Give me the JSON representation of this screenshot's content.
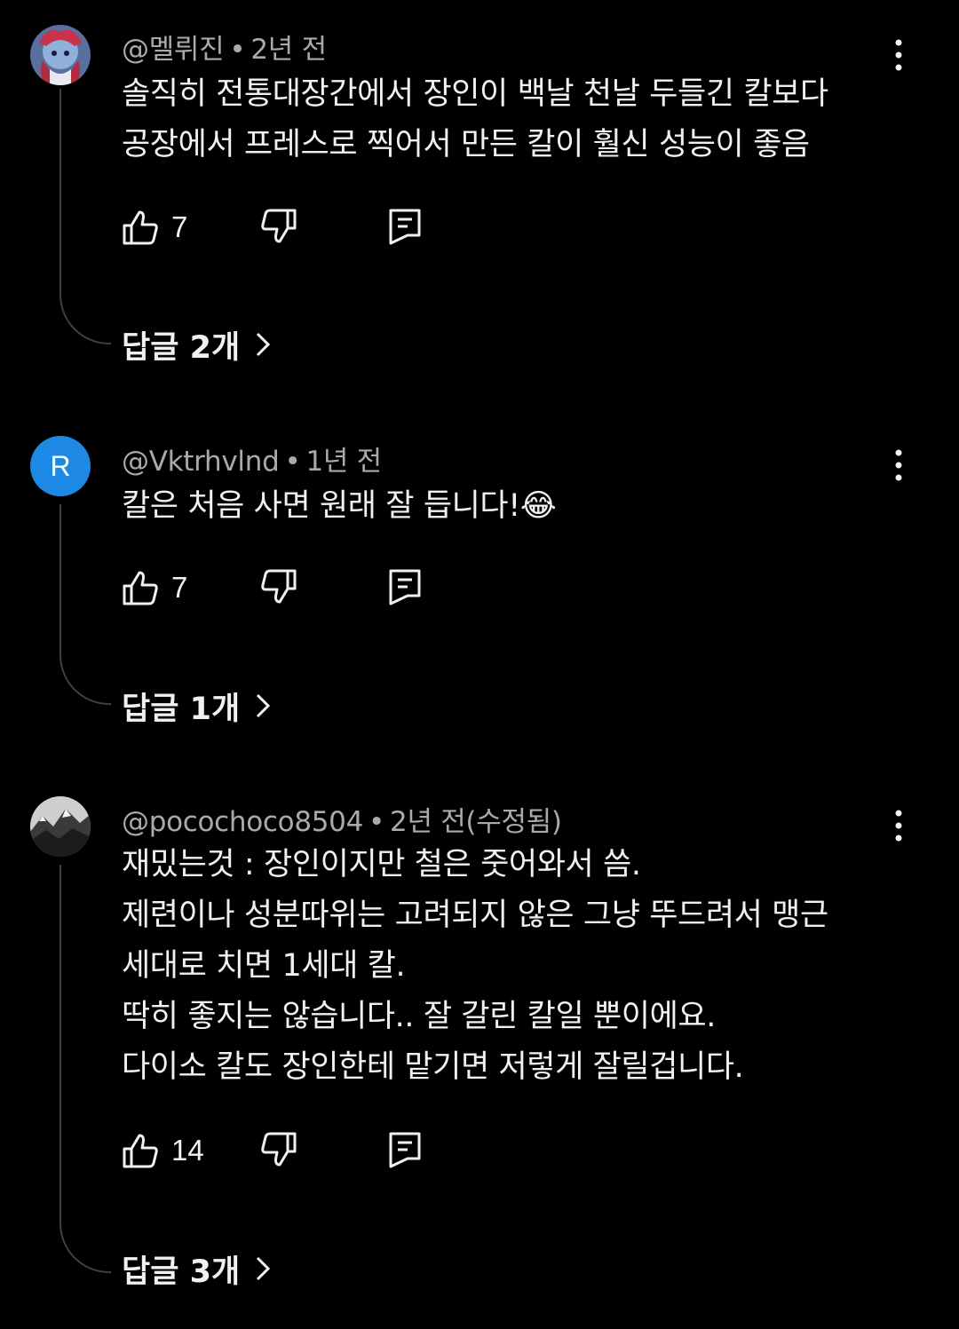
{
  "colors": {
    "background": "#000000",
    "text_primary": "#f1f1f1",
    "text_secondary": "#aaaaaa",
    "thread_line": "#3f3f3f",
    "avatar_letter_bg": "#1e88e5"
  },
  "comments": [
    {
      "author": "@멜뤼진",
      "time": "2년 전",
      "avatar": {
        "type": "image",
        "icon": "anime-avatar"
      },
      "lines": [
        "솔직히 전통대장간에서 장인이 백날 천날 두들긴 칼보다",
        "공장에서 프레스로 찍어서 만든 칼이 훨신 성능이 좋음"
      ],
      "likes": "7",
      "replies_label": "답글 2개"
    },
    {
      "author": "@Vktrhvlnd",
      "time": "1년 전",
      "avatar": {
        "type": "letter",
        "letter": "R"
      },
      "lines": [
        "칼은 처음 사면 원래 잘 듭니다!"
      ],
      "emoji": "😂",
      "likes": "7",
      "replies_label": "답글 1개"
    },
    {
      "author": "@pocochoco8504",
      "time": "2년 전(수정됨)",
      "avatar": {
        "type": "image",
        "icon": "landscape-avatar"
      },
      "lines": [
        "재밌는것 : 장인이지만 철은 줏어와서 씀.",
        "제련이나 성분따위는 고려되지 않은 그냥 뚜드려서 맹근",
        "세대로 치면 1세대 칼.",
        "딱히 좋지는 않습니다.. 잘 갈린 칼일 뿐이에요.",
        "다이소 칼도 장인한테 맡기면 저렇게 잘릴겁니다."
      ],
      "likes": "14",
      "replies_label": "답글 3개"
    }
  ],
  "separator": "•"
}
